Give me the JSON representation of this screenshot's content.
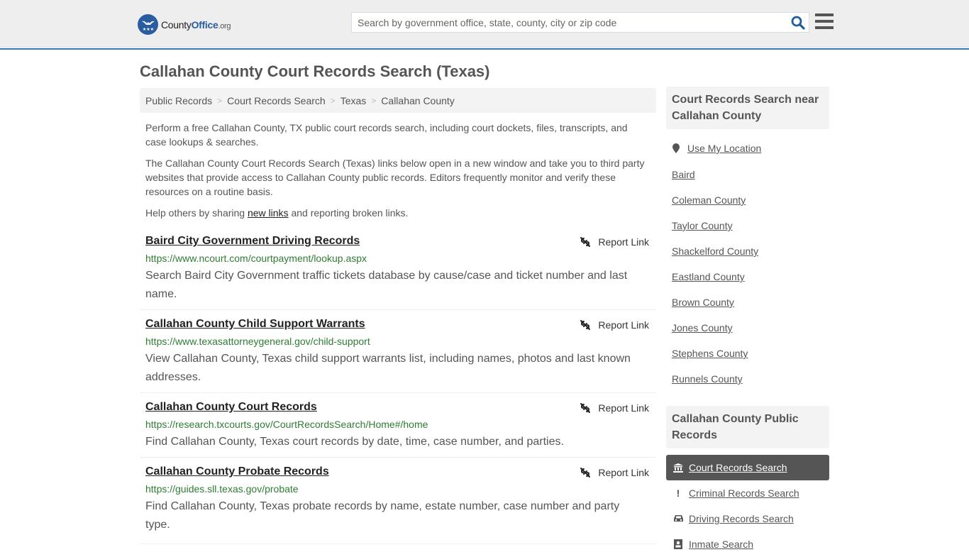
{
  "header": {
    "logo": {
      "name_main": "County",
      "name_accent": "Office",
      "name_suffix": ".org"
    },
    "search": {
      "placeholder": "Search by government office, state, county, city or zip code",
      "value": ""
    },
    "colors": {
      "brand": "#2a5d9f",
      "accent_bar": "#3a7dab"
    }
  },
  "page": {
    "title": "Callahan County Court Records Search (Texas)"
  },
  "breadcrumb": [
    {
      "label": "Public Records"
    },
    {
      "label": "Court Records Search"
    },
    {
      "label": "Texas"
    },
    {
      "label": "Callahan County"
    }
  ],
  "breadcrumb_separator": ">",
  "intro": {
    "p1": "Perform a free Callahan County, TX public court records search, including court dockets, files, transcripts, and case lookups & searches.",
    "p2": "The Callahan County Court Records Search (Texas) links below open in a new window and take you to third party websites that provide access to Callahan County public records. Editors frequently monitor and verify these resources on a routine basis.",
    "p3_before": "Help others by sharing ",
    "p3_link": "new links",
    "p3_after": " and reporting broken links."
  },
  "links": [
    {
      "title": "Baird City Government Driving Records",
      "url": "https://www.ncourt.com/courtpayment/lookup.aspx",
      "description": "Search Baird City Government traffic tickets database by cause/case and ticket number and last name.",
      "report_label": "Report Link"
    },
    {
      "title": "Callahan County Child Support Warrants",
      "url": "https://www.texasattorneygeneral.gov/child-support",
      "description": "View Callahan County, Texas child support warrants list, including names, photos and last known addresses.",
      "report_label": "Report Link"
    },
    {
      "title": "Callahan County Court Records",
      "url": "https://research.txcourts.gov/CourtRecordsSearch/Home#/home",
      "description": "Find Callahan County, Texas court records by date, time, case number, and parties.",
      "report_label": "Report Link"
    },
    {
      "title": "Callahan County Probate Records",
      "url": "https://guides.sll.texas.gov/probate",
      "description": "Find Callahan County, Texas probate records by name, estate number, case number and party type.",
      "report_label": "Report Link"
    }
  ],
  "sidebar": {
    "nearby_heading": "Court Records Search near Callahan County",
    "use_location": "Use My Location",
    "nearby": [
      "Baird",
      "Coleman County",
      "Taylor County",
      "Shackelford County",
      "Eastland County",
      "Brown County",
      "Jones County",
      "Stephens County",
      "Runnels County"
    ],
    "public_records_heading": "Callahan County Public Records",
    "public_records": [
      {
        "label": "Court Records Search",
        "icon": "courthouse-icon",
        "active": true
      },
      {
        "label": "Criminal Records Search",
        "icon": "exclamation-icon",
        "active": false
      },
      {
        "label": "Driving Records Search",
        "icon": "car-icon",
        "active": false
      },
      {
        "label": "Inmate Search",
        "icon": "inmate-icon",
        "active": false
      }
    ]
  }
}
